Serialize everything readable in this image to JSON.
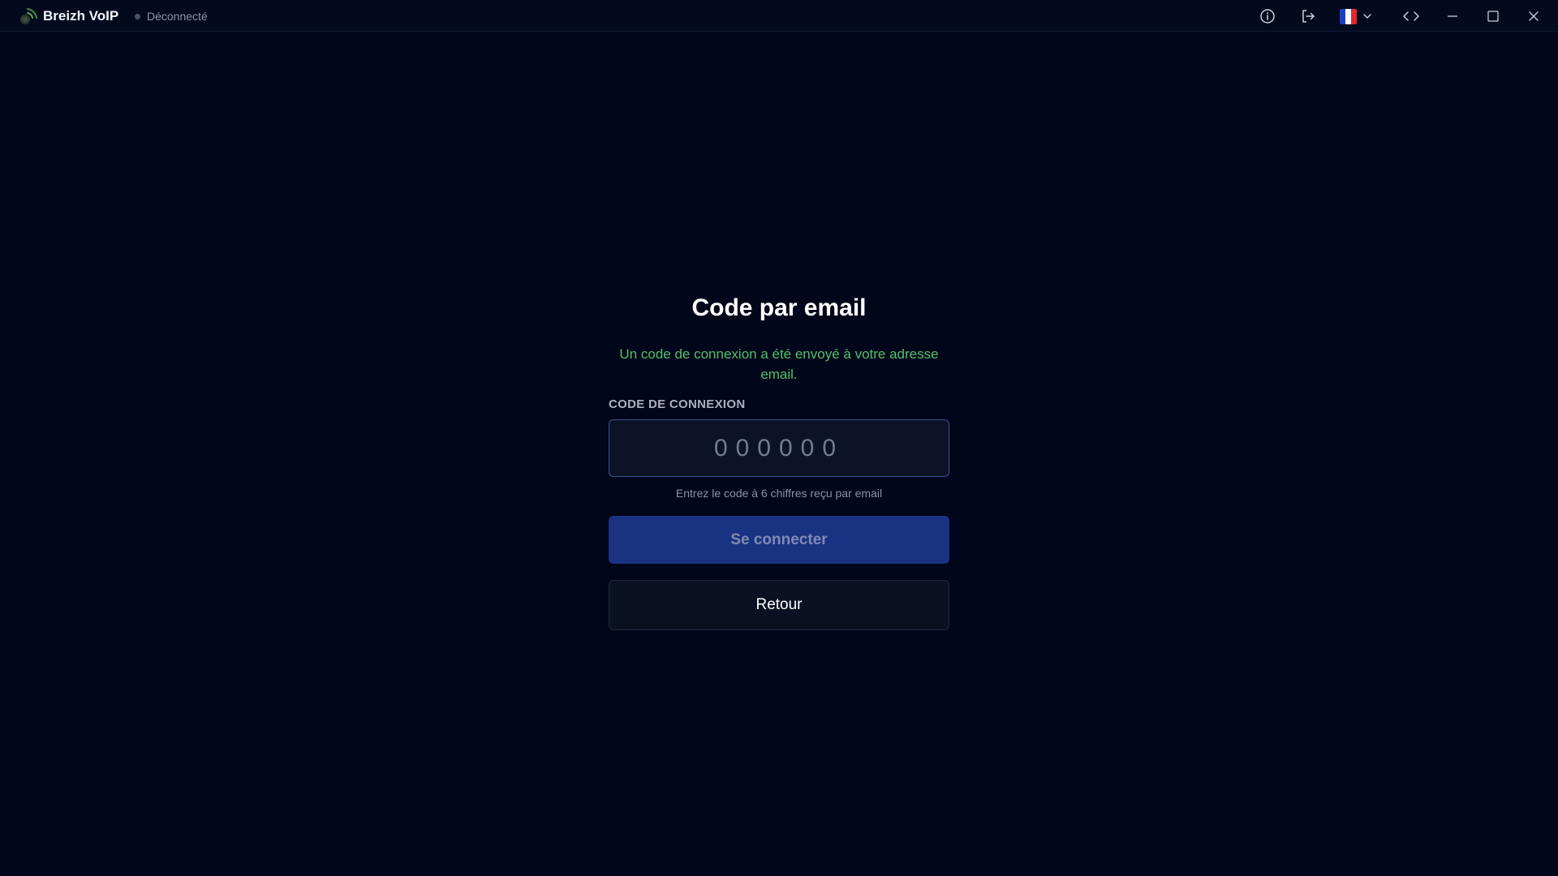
{
  "app": {
    "name": "Breizh VoIP",
    "status": "Déconnecté",
    "status_color": "#4a5268"
  },
  "titlebar": {
    "icons": [
      "info-icon",
      "logout-icon",
      "flag-fr-icon",
      "chevron-down-icon",
      "code-icon",
      "minimize-icon",
      "maximize-icon",
      "close-icon"
    ]
  },
  "login": {
    "title": "Code par email",
    "message": "Un code de connexion a été envoyé à votre adresse email.",
    "field_label": "CODE DE CONNEXION",
    "code_value": "",
    "code_placeholder": "000000",
    "hint": "Entrez le code à 6 chiffres reçu par email",
    "submit_label": "Se connecter",
    "back_label": "Retour"
  },
  "colors": {
    "background": "#02061a",
    "success_text": "#4fc26b",
    "primary_button": "#1a3282",
    "input_border": "#3b4f8f"
  }
}
